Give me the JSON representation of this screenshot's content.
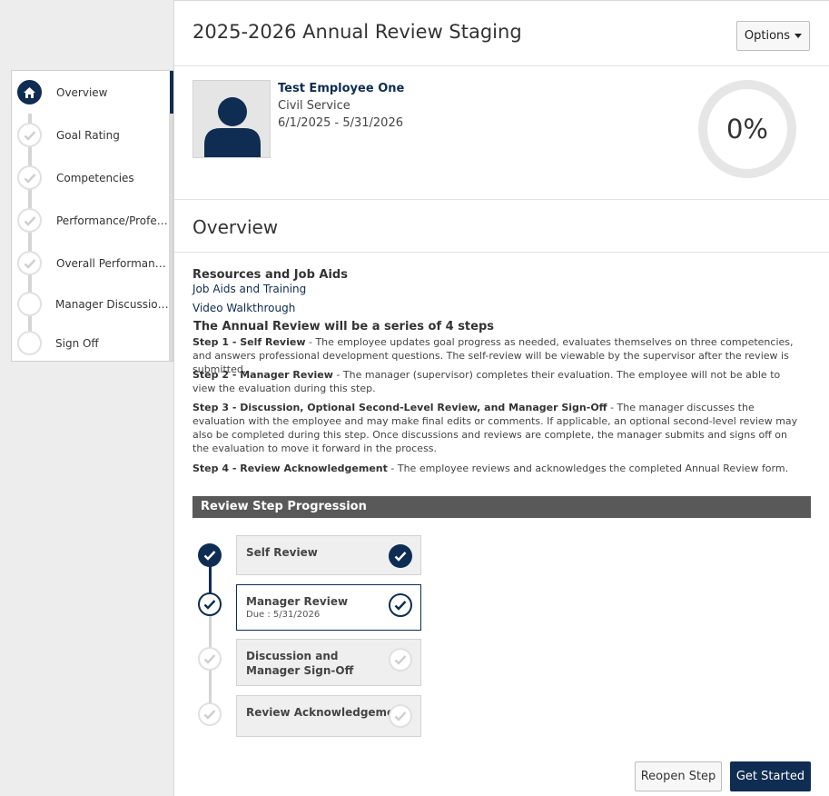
{
  "sidebar": {
    "items": [
      {
        "label": "Overview",
        "status": "active"
      },
      {
        "label": "Goal Rating",
        "status": "complete"
      },
      {
        "label": "Competencies",
        "status": "complete"
      },
      {
        "label": "Performance/Professi...",
        "status": "complete"
      },
      {
        "label": "Overall Performance R...",
        "status": "complete"
      },
      {
        "label": "Manager Discussion, R...",
        "status": "pending"
      },
      {
        "label": "Sign Off",
        "status": "pending"
      }
    ]
  },
  "header": {
    "title": "2025-2026 Annual Review Staging",
    "options_label": "Options"
  },
  "employee": {
    "name": "Test Employee One",
    "type": "Civil Service",
    "dates": "6/1/2025 - 5/31/2026",
    "progress_label": "0%",
    "progress_value": 0
  },
  "overview": {
    "title": "Overview",
    "resources_heading": "Resources and Job Aids",
    "links": [
      "Job Aids and Training",
      "Video Walkthrough"
    ],
    "steps_heading": "The Annual Review will be a series of 4 steps",
    "steps": [
      {
        "label": "Step 1 - Self Review",
        "text": " - The employee updates goal progress as needed, evaluates themselves on three competencies, and answers professional development questions. The self-review will be viewable by the supervisor after the review is submitted."
      },
      {
        "label": "Step 2 - Manager Review",
        "text": " - The manager (supervisor) completes their evaluation. The employee will not be able to view the evaluation during this step."
      },
      {
        "label": "Step 3 - Discussion, Optional Second-Level Review, and Manager Sign-Off",
        "text": " - The manager discusses the evaluation with the employee and may make final edits or comments. If applicable, an optional second-level review may also be completed during this step. Once discussions and reviews are complete, the manager submits and signs off on the evaluation to move it forward in the process."
      },
      {
        "label": "Step 4 - Review Acknowledgement",
        "text": " - The employee reviews and acknowledges the completed Annual Review form."
      }
    ]
  },
  "progression": {
    "heading": "Review Step Progression",
    "steps": [
      {
        "title": "Self Review",
        "due": "",
        "status": "complete"
      },
      {
        "title": "Manager Review",
        "due": "Due :  5/31/2026",
        "status": "current"
      },
      {
        "title": "Discussion and Manager Sign-Off",
        "due": "",
        "status": "pending"
      },
      {
        "title": "Review Acknowledgement",
        "due": "",
        "status": "pending"
      }
    ]
  },
  "actions": {
    "reopen_label": "Reopen Step",
    "start_label": "Get Started"
  },
  "colors": {
    "brand": "#0f2d52",
    "bar": "#595959",
    "pending": "#d5d5d5"
  }
}
